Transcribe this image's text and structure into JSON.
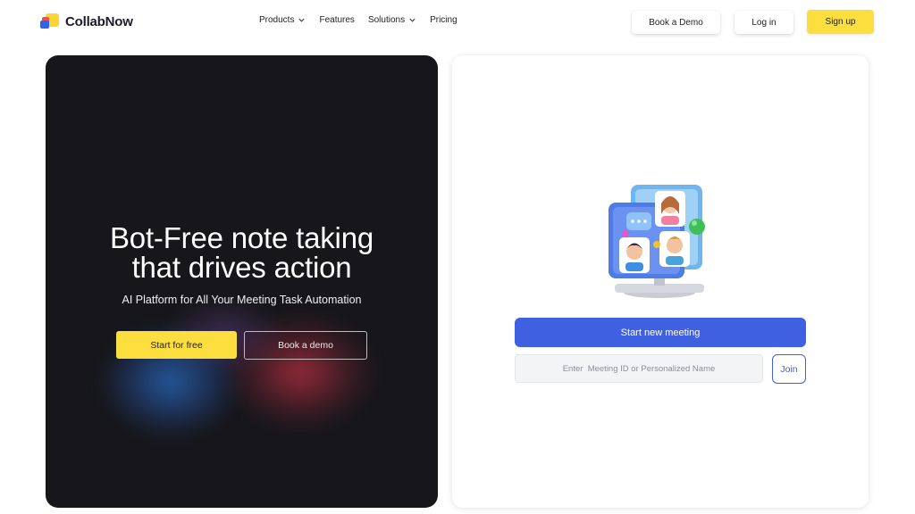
{
  "brand": {
    "name": "CollabNow",
    "colors": {
      "yellow": "#fcd535",
      "red": "#ef4d5a",
      "blue": "#2f63e8"
    }
  },
  "nav": {
    "items": [
      {
        "label": "Products",
        "has_dropdown": true
      },
      {
        "label": "Features",
        "has_dropdown": false
      },
      {
        "label": "Solutions",
        "has_dropdown": true
      },
      {
        "label": "Pricing",
        "has_dropdown": false
      }
    ]
  },
  "header_actions": {
    "book_demo": "Book a Demo",
    "login": "Log in",
    "signup": "Sign up"
  },
  "hero": {
    "title_line1": "Bot-Free note taking",
    "title_line2": "that drives action",
    "subtitle": "AI Platform for All Your Meeting Task Automation",
    "start_button": "Start for free",
    "demo_button": "Book a demo"
  },
  "meeting": {
    "start_button": "Start new meeting",
    "input_placeholder": "Enter  Meeting ID or Personalized Name",
    "join_button": "Join",
    "accent_color": "#3f60e0"
  }
}
